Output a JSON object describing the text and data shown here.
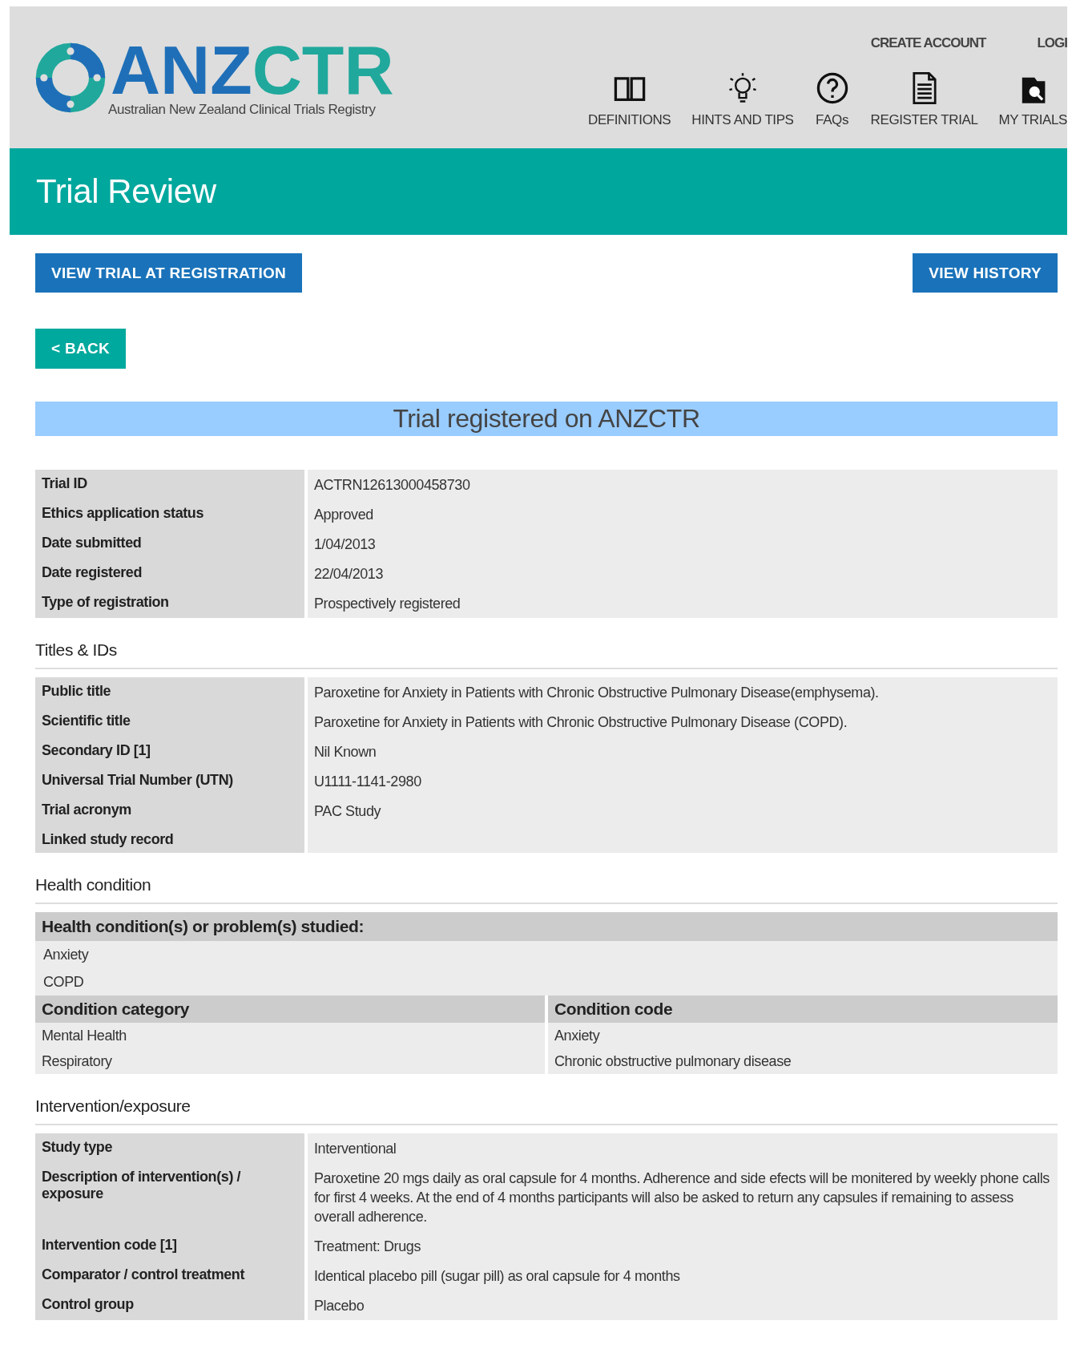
{
  "header": {
    "logo": {
      "part1": "ANZ",
      "part2": "CTR",
      "subtitle": "Australian New Zealand Clinical Trials Registry"
    },
    "top_links": [
      "CREATE ACCOUNT",
      "LOGI"
    ],
    "nav": [
      "DEFINITIONS",
      "HINTS AND TIPS",
      "FAQs",
      "REGISTER TRIAL",
      "MY TRIALS"
    ]
  },
  "page_title": "Trial Review",
  "actions": {
    "left": "VIEW TRIAL AT REGISTRATION",
    "right": "VIEW HISTORY",
    "back": "< BACK"
  },
  "banner": "Trial registered on ANZCTR",
  "sections": [
    {
      "kind": "pairs",
      "rows": [
        {
          "label": "Trial ID",
          "value": "ACTRN12613000458730"
        },
        {
          "label": "Ethics application status",
          "value": "Approved"
        },
        {
          "label": "Date submitted",
          "value": "1/04/2013"
        },
        {
          "label": "Date registered",
          "value": "22/04/2013"
        },
        {
          "label": "Type of registration",
          "value": "Prospectively registered"
        }
      ]
    },
    {
      "kind": "pairs",
      "heading": "Titles & IDs",
      "rows": [
        {
          "label": "Public title",
          "value": "Paroxetine for Anxiety in Patients with Chronic Obstructive Pulmonary Disease(emphysema)."
        },
        {
          "label": "Scientific title",
          "value": "Paroxetine for Anxiety in Patients with Chronic Obstructive Pulmonary Disease (COPD)."
        },
        {
          "label": "Secondary ID [1]",
          "value": "Nil Known"
        },
        {
          "label": "Universal Trial Number (UTN)",
          "value": "U1111-1141-2980"
        },
        {
          "label": "Trial acronym",
          "value": "PAC Study"
        },
        {
          "label": "Linked study record"
        }
      ]
    },
    {
      "kind": "conditions",
      "heading": "Health condition",
      "problems_header": "Health condition(s) or problem(s) studied:",
      "problems": [
        "Anxiety",
        "COPD"
      ],
      "columns": [
        "Condition category",
        "Condition code"
      ],
      "rows": [
        [
          "Mental Health",
          "Anxiety"
        ],
        [
          "Respiratory",
          "Chronic obstructive pulmonary disease"
        ]
      ]
    },
    {
      "kind": "pairs",
      "heading": "Intervention/exposure",
      "rows": [
        {
          "label": "Study type",
          "value": "Interventional"
        },
        {
          "label": "Description of intervention(s) / exposure",
          "value": "Paroxetine 20 mgs daily as oral capsule for 4 months. Adherence and side efects will be monitered by weekly phone calls for first 4 weeks. At the end of 4 months participants will also be asked to return any capsules if remaining to assess overall adherence."
        },
        {
          "label": "Intervention code [1]",
          "value": "Treatment: Drugs"
        },
        {
          "label": "Comparator / control treatment",
          "value": "Identical placebo pill (sugar pill) as oral capsule for 4 months"
        },
        {
          "label": "Control group",
          "value": "Placebo"
        }
      ]
    }
  ]
}
